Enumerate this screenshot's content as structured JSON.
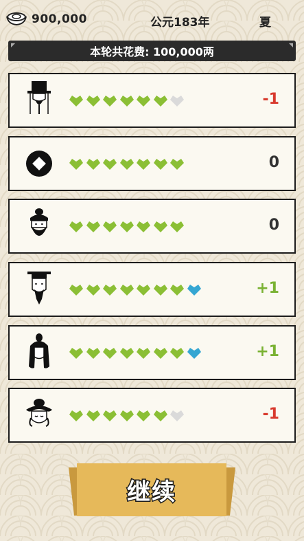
{
  "header": {
    "money": "900,000",
    "year": "公元183年",
    "season": "夏"
  },
  "cost_banner": "本轮共花费: 100,000两",
  "rows": [
    {
      "icon": "official-tall-hat-icon",
      "green": 6,
      "blue": 0,
      "empty": 1,
      "delta": "-1",
      "delta_color": "#d83a2e"
    },
    {
      "icon": "coin-icon",
      "green": 7,
      "blue": 0,
      "empty": 0,
      "delta": "0",
      "delta_color": "#333333"
    },
    {
      "icon": "bearded-scholar-icon",
      "green": 7,
      "blue": 0,
      "empty": 0,
      "delta": "0",
      "delta_color": "#333333"
    },
    {
      "icon": "minister-hat-icon",
      "green": 7,
      "blue": 1,
      "empty": 0,
      "delta": "+1",
      "delta_color": "#7ab233"
    },
    {
      "icon": "warrior-bun-icon",
      "green": 7,
      "blue": 1,
      "empty": 0,
      "delta": "+1",
      "delta_color": "#7ab233"
    },
    {
      "icon": "lady-hairpiece-icon",
      "green": 6,
      "blue": 0,
      "empty": 1,
      "delta": "-1",
      "delta_color": "#d83a2e"
    }
  ],
  "colors": {
    "green_heart": "#8bbf35",
    "blue_heart": "#35a6d2",
    "empty_heart": "#dadada"
  },
  "continue_label": "继续"
}
